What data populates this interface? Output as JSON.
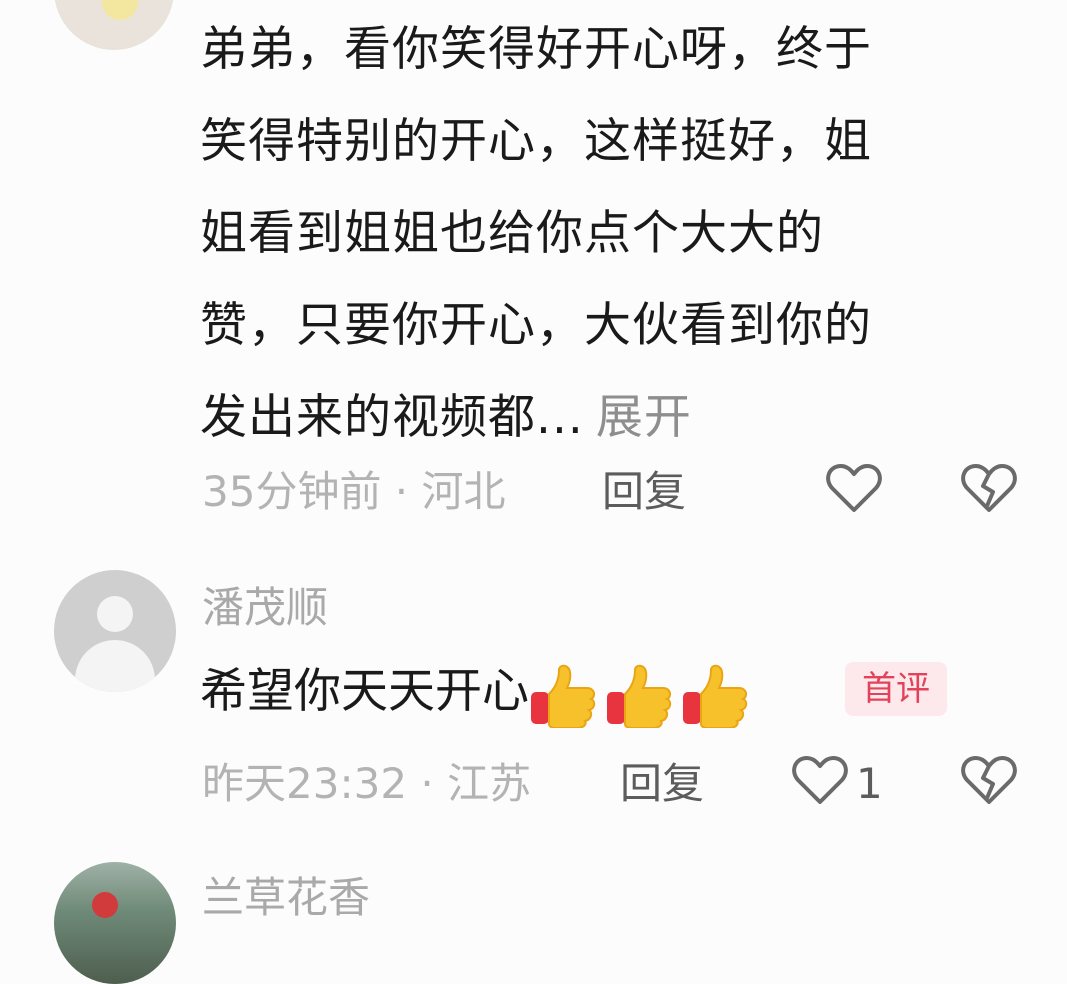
{
  "comments": [
    {
      "text_lines": [
        "弟弟，看你笑得好开心呀，终于",
        "笑得特别的开心，这样挺好，姐",
        "姐看到姐姐也给你点个大大的",
        "赞，只要你开心，大伙看到你的",
        "发出来的视频都..."
      ],
      "expand_label": "展开",
      "meta": "35分钟前 · 河北",
      "reply_label": "回复"
    },
    {
      "username": "潘茂顺",
      "text": "希望你天天开心",
      "emoji": [
        "thumbs-up",
        "thumbs-up",
        "thumbs-up"
      ],
      "badge": "首评",
      "meta": "昨天23:32 · 江苏",
      "reply_label": "回复",
      "like_count": "1"
    },
    {
      "username": "兰草花香"
    }
  ],
  "colors": {
    "badge_bg": "#fde9ec",
    "badge_text": "#e3435a",
    "meta_text": "#b3b3b3",
    "username_text": "#a9a9a9"
  }
}
